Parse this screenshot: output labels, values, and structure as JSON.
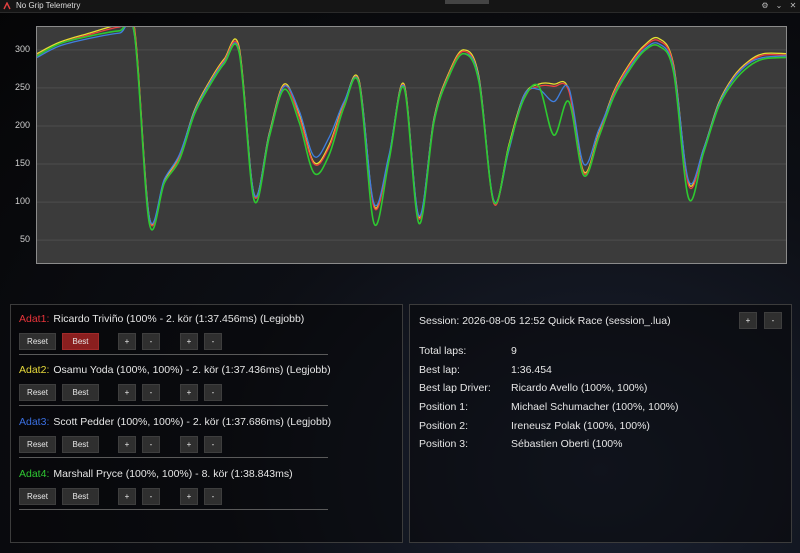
{
  "window": {
    "title": "No Grip Telemetry",
    "settings_icon": "gear-icon",
    "collapse_icon": "chevron-down-icon",
    "close_icon": "close-icon"
  },
  "chart_data": {
    "type": "line",
    "yticks": [
      50,
      100,
      150,
      200,
      250,
      300
    ],
    "ylim": [
      20,
      330
    ],
    "xlim": [
      0,
      100
    ],
    "grid": true,
    "series": [
      {
        "color": "#e8e030",
        "x": [
          0,
          3,
          7,
          11,
          13,
          15,
          17,
          19,
          21,
          23,
          25,
          27,
          29,
          31,
          33,
          35,
          37,
          39,
          41,
          43,
          45,
          47,
          49,
          51,
          53,
          55,
          57,
          59,
          61,
          63,
          65,
          67,
          69,
          71,
          73,
          75,
          77,
          79,
          81,
          83,
          85,
          87,
          89,
          91,
          93,
          95,
          97,
          100
        ],
        "values": [
          295,
          310,
          322,
          333,
          330,
          80,
          128,
          160,
          220,
          258,
          288,
          303,
          110,
          190,
          255,
          215,
          152,
          175,
          230,
          260,
          95,
          160,
          255,
          80,
          210,
          270,
          300,
          265,
          100,
          175,
          240,
          255,
          255,
          248,
          140,
          190,
          245,
          280,
          305,
          315,
          280,
          125,
          170,
          230,
          265,
          285,
          295,
          295
        ]
      },
      {
        "color": "#ef4040",
        "x": [
          0,
          3,
          7,
          11,
          13,
          15,
          17,
          19,
          21,
          23,
          25,
          27,
          29,
          31,
          33,
          35,
          37,
          39,
          41,
          43,
          45,
          47,
          49,
          51,
          53,
          55,
          57,
          59,
          61,
          63,
          65,
          67,
          69,
          71,
          73,
          75,
          77,
          79,
          81,
          83,
          85,
          87,
          89,
          91,
          93,
          95,
          97,
          100
        ],
        "values": [
          293,
          308,
          320,
          330,
          328,
          78,
          126,
          158,
          218,
          256,
          286,
          300,
          108,
          188,
          253,
          212,
          150,
          172,
          228,
          258,
          93,
          158,
          253,
          78,
          208,
          268,
          298,
          262,
          98,
          172,
          238,
          252,
          252,
          246,
          138,
          188,
          243,
          278,
          303,
          312,
          278,
          122,
          168,
          228,
          263,
          283,
          293,
          293
        ]
      },
      {
        "color": "#3f7fe0",
        "x": [
          0,
          3,
          7,
          11,
          13,
          15,
          17,
          19,
          21,
          23,
          25,
          27,
          29,
          31,
          33,
          35,
          37,
          39,
          41,
          43,
          45,
          47,
          49,
          51,
          53,
          55,
          57,
          59,
          61,
          63,
          65,
          67,
          69,
          71,
          73,
          75,
          77,
          79,
          81,
          83,
          85,
          87,
          89,
          91,
          93,
          95,
          97,
          100
        ],
        "values": [
          290,
          305,
          315,
          322,
          320,
          80,
          130,
          162,
          218,
          255,
          284,
          298,
          110,
          188,
          252,
          220,
          160,
          185,
          232,
          257,
          98,
          162,
          252,
          82,
          208,
          266,
          295,
          262,
          102,
          168,
          240,
          248,
          232,
          250,
          150,
          195,
          240,
          275,
          300,
          308,
          275,
          128,
          170,
          228,
          262,
          282,
          290,
          292
        ]
      },
      {
        "color": "#2ec830",
        "x": [
          0,
          3,
          7,
          11,
          13,
          15,
          17,
          19,
          21,
          23,
          25,
          27,
          29,
          31,
          33,
          35,
          37,
          39,
          41,
          43,
          45,
          47,
          49,
          51,
          53,
          55,
          57,
          59,
          61,
          63,
          65,
          67,
          69,
          71,
          73,
          75,
          77,
          79,
          81,
          83,
          85,
          87,
          89,
          91,
          93,
          95,
          97,
          100
        ],
        "values": [
          292,
          308,
          318,
          325,
          322,
          72,
          125,
          155,
          215,
          252,
          282,
          296,
          102,
          185,
          248,
          205,
          138,
          162,
          225,
          255,
          72,
          155,
          250,
          72,
          205,
          265,
          295,
          258,
          100,
          172,
          235,
          252,
          188,
          232,
          135,
          185,
          238,
          272,
          298,
          305,
          270,
          105,
          165,
          225,
          258,
          278,
          288,
          290
        ]
      }
    ]
  },
  "drivers": [
    {
      "tag": "Adat1:",
      "tag_color": "#e8343a",
      "text": "Ricardo Triviño (100% - 2. kör (1:37.456ms) (Legjobb)",
      "best_active": true
    },
    {
      "tag": "Adat2:",
      "tag_color": "#e6d93a",
      "text": "Osamu Yoda (100%, 100%) - 2. kör (1:37.436ms) (Legjobb)",
      "best_active": false
    },
    {
      "tag": "Adat3:",
      "tag_color": "#3a6fe0",
      "text": "Scott Pedder (100%, 100%) - 2. kör (1:37.686ms) (Legjobb)",
      "best_active": false
    },
    {
      "tag": "Adat4:",
      "tag_color": "#2fc832",
      "text": "Marshall Pryce (100%, 100%) - 8. kör (1:38.843ms)",
      "best_active": false
    }
  ],
  "buttons": {
    "reset": "Reset",
    "best": "Best",
    "plus": "+",
    "minus": "-"
  },
  "session": {
    "line": "Session: 2026-08-05 12:52 Quick Race   (session_.lua)",
    "info": [
      {
        "label": "Total laps:",
        "value": "9"
      },
      {
        "label": "Best lap:",
        "value": "1:36.454"
      },
      {
        "label": "Best lap Driver:",
        "value": "Ricardo Avello (100%, 100%)"
      },
      {
        "label": "Position 1:",
        "value": "Michael Schumacher (100%, 100%)"
      },
      {
        "label": "Position 2:",
        "value": "Ireneusz Polak (100%, 100%)"
      },
      {
        "label": "Position 3:",
        "value": "Sébastien Oberti (100%"
      }
    ]
  }
}
